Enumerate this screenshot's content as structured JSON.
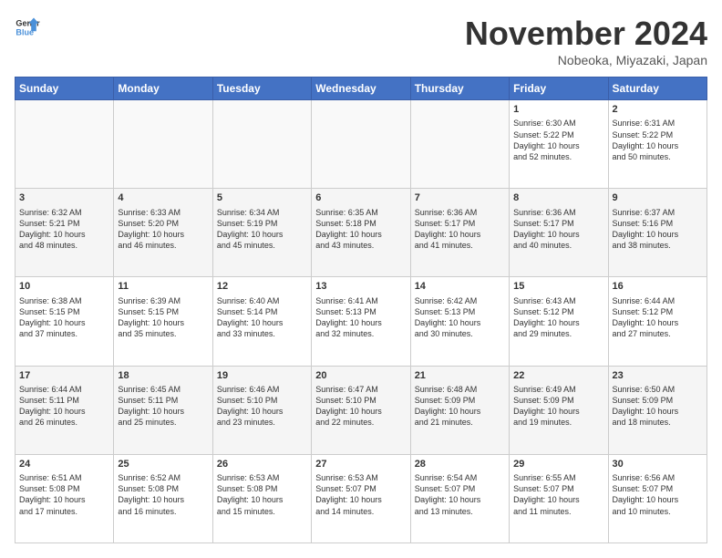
{
  "logo": {
    "line1": "General",
    "line2": "Blue"
  },
  "title": "November 2024",
  "location": "Nobeoka, Miyazaki, Japan",
  "days_of_week": [
    "Sunday",
    "Monday",
    "Tuesday",
    "Wednesday",
    "Thursday",
    "Friday",
    "Saturday"
  ],
  "weeks": [
    [
      {
        "day": "",
        "content": ""
      },
      {
        "day": "",
        "content": ""
      },
      {
        "day": "",
        "content": ""
      },
      {
        "day": "",
        "content": ""
      },
      {
        "day": "",
        "content": ""
      },
      {
        "day": "1",
        "content": "Sunrise: 6:30 AM\nSunset: 5:22 PM\nDaylight: 10 hours\nand 52 minutes."
      },
      {
        "day": "2",
        "content": "Sunrise: 6:31 AM\nSunset: 5:22 PM\nDaylight: 10 hours\nand 50 minutes."
      }
    ],
    [
      {
        "day": "3",
        "content": "Sunrise: 6:32 AM\nSunset: 5:21 PM\nDaylight: 10 hours\nand 48 minutes."
      },
      {
        "day": "4",
        "content": "Sunrise: 6:33 AM\nSunset: 5:20 PM\nDaylight: 10 hours\nand 46 minutes."
      },
      {
        "day": "5",
        "content": "Sunrise: 6:34 AM\nSunset: 5:19 PM\nDaylight: 10 hours\nand 45 minutes."
      },
      {
        "day": "6",
        "content": "Sunrise: 6:35 AM\nSunset: 5:18 PM\nDaylight: 10 hours\nand 43 minutes."
      },
      {
        "day": "7",
        "content": "Sunrise: 6:36 AM\nSunset: 5:17 PM\nDaylight: 10 hours\nand 41 minutes."
      },
      {
        "day": "8",
        "content": "Sunrise: 6:36 AM\nSunset: 5:17 PM\nDaylight: 10 hours\nand 40 minutes."
      },
      {
        "day": "9",
        "content": "Sunrise: 6:37 AM\nSunset: 5:16 PM\nDaylight: 10 hours\nand 38 minutes."
      }
    ],
    [
      {
        "day": "10",
        "content": "Sunrise: 6:38 AM\nSunset: 5:15 PM\nDaylight: 10 hours\nand 37 minutes."
      },
      {
        "day": "11",
        "content": "Sunrise: 6:39 AM\nSunset: 5:15 PM\nDaylight: 10 hours\nand 35 minutes."
      },
      {
        "day": "12",
        "content": "Sunrise: 6:40 AM\nSunset: 5:14 PM\nDaylight: 10 hours\nand 33 minutes."
      },
      {
        "day": "13",
        "content": "Sunrise: 6:41 AM\nSunset: 5:13 PM\nDaylight: 10 hours\nand 32 minutes."
      },
      {
        "day": "14",
        "content": "Sunrise: 6:42 AM\nSunset: 5:13 PM\nDaylight: 10 hours\nand 30 minutes."
      },
      {
        "day": "15",
        "content": "Sunrise: 6:43 AM\nSunset: 5:12 PM\nDaylight: 10 hours\nand 29 minutes."
      },
      {
        "day": "16",
        "content": "Sunrise: 6:44 AM\nSunset: 5:12 PM\nDaylight: 10 hours\nand 27 minutes."
      }
    ],
    [
      {
        "day": "17",
        "content": "Sunrise: 6:44 AM\nSunset: 5:11 PM\nDaylight: 10 hours\nand 26 minutes."
      },
      {
        "day": "18",
        "content": "Sunrise: 6:45 AM\nSunset: 5:11 PM\nDaylight: 10 hours\nand 25 minutes."
      },
      {
        "day": "19",
        "content": "Sunrise: 6:46 AM\nSunset: 5:10 PM\nDaylight: 10 hours\nand 23 minutes."
      },
      {
        "day": "20",
        "content": "Sunrise: 6:47 AM\nSunset: 5:10 PM\nDaylight: 10 hours\nand 22 minutes."
      },
      {
        "day": "21",
        "content": "Sunrise: 6:48 AM\nSunset: 5:09 PM\nDaylight: 10 hours\nand 21 minutes."
      },
      {
        "day": "22",
        "content": "Sunrise: 6:49 AM\nSunset: 5:09 PM\nDaylight: 10 hours\nand 19 minutes."
      },
      {
        "day": "23",
        "content": "Sunrise: 6:50 AM\nSunset: 5:09 PM\nDaylight: 10 hours\nand 18 minutes."
      }
    ],
    [
      {
        "day": "24",
        "content": "Sunrise: 6:51 AM\nSunset: 5:08 PM\nDaylight: 10 hours\nand 17 minutes."
      },
      {
        "day": "25",
        "content": "Sunrise: 6:52 AM\nSunset: 5:08 PM\nDaylight: 10 hours\nand 16 minutes."
      },
      {
        "day": "26",
        "content": "Sunrise: 6:53 AM\nSunset: 5:08 PM\nDaylight: 10 hours\nand 15 minutes."
      },
      {
        "day": "27",
        "content": "Sunrise: 6:53 AM\nSunset: 5:07 PM\nDaylight: 10 hours\nand 14 minutes."
      },
      {
        "day": "28",
        "content": "Sunrise: 6:54 AM\nSunset: 5:07 PM\nDaylight: 10 hours\nand 13 minutes."
      },
      {
        "day": "29",
        "content": "Sunrise: 6:55 AM\nSunset: 5:07 PM\nDaylight: 10 hours\nand 11 minutes."
      },
      {
        "day": "30",
        "content": "Sunrise: 6:56 AM\nSunset: 5:07 PM\nDaylight: 10 hours\nand 10 minutes."
      }
    ]
  ]
}
